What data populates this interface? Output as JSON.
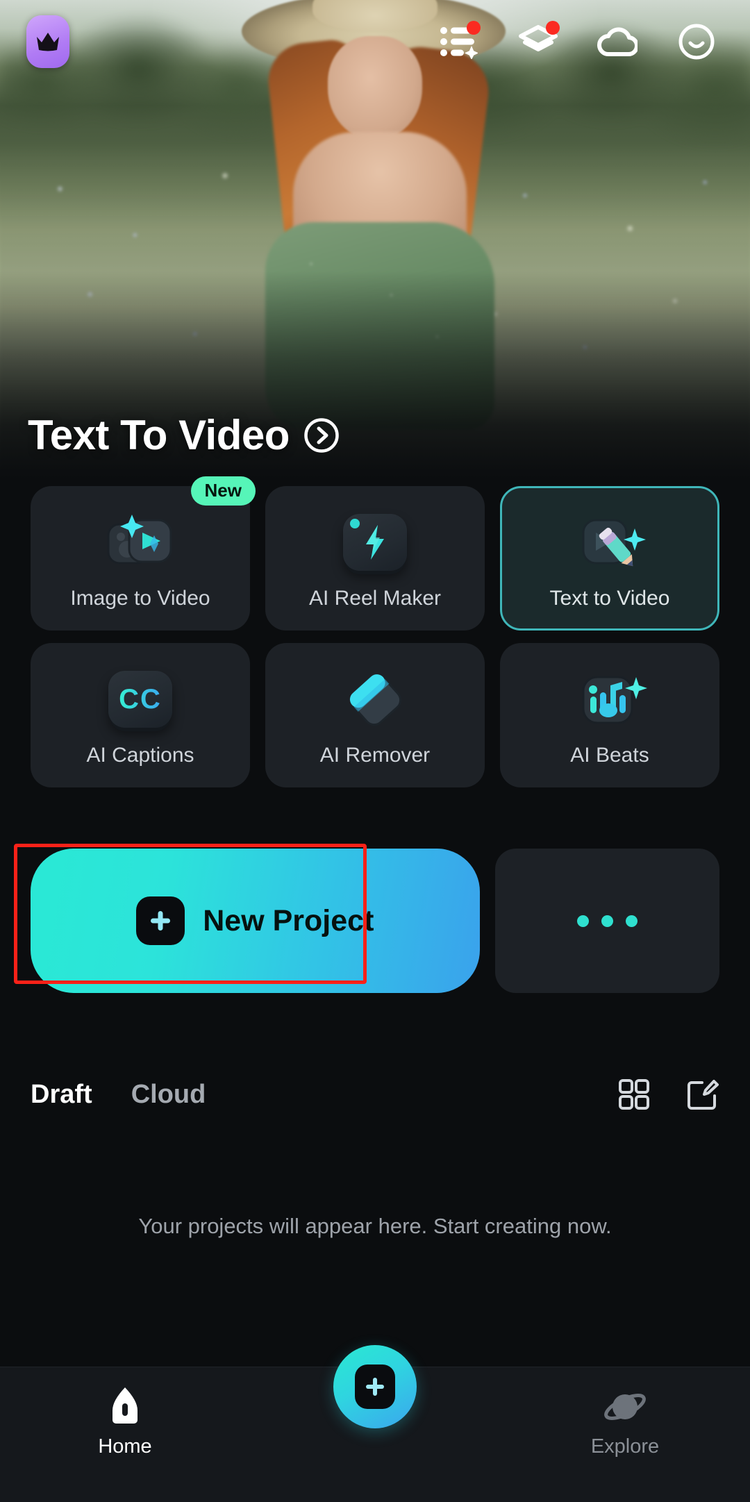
{
  "topbar": {
    "crown_icon": "crown-icon",
    "icons": [
      {
        "name": "ai-list-sparkle-icon",
        "badge": true
      },
      {
        "name": "graduation-cap-icon",
        "badge": true
      },
      {
        "name": "cloud-icon",
        "badge": false
      },
      {
        "name": "smiley-face-icon",
        "badge": false
      }
    ]
  },
  "hero": {
    "title": "Text To Video",
    "arrow_icon": "chevron-right-circle-icon"
  },
  "features": [
    {
      "label": "Image to Video",
      "icon": "image-to-video-icon",
      "badge": "New",
      "highlighted": false
    },
    {
      "label": "AI Reel Maker",
      "icon": "lightning-bolt-icon",
      "badge": "",
      "highlighted": false
    },
    {
      "label": "Text to Video",
      "icon": "pencil-play-icon",
      "badge": "",
      "highlighted": true
    },
    {
      "label": "AI Captions",
      "icon": "closed-caption-icon",
      "badge": "",
      "highlighted": false
    },
    {
      "label": "AI Remover",
      "icon": "eraser-icon",
      "badge": "",
      "highlighted": false
    },
    {
      "label": "AI Beats",
      "icon": "music-note-sparkle-icon",
      "badge": "",
      "highlighted": false
    }
  ],
  "new_project": {
    "label": "New Project",
    "plus_icon": "plus-icon",
    "more_icon": "more-horizontal-icon"
  },
  "projects": {
    "tabs": [
      {
        "label": "Draft",
        "active": true
      },
      {
        "label": "Cloud",
        "active": false
      }
    ],
    "grid_view_icon": "grid-view-icon",
    "edit_icon": "edit-square-icon",
    "empty_message": "Your projects will appear here. Start creating now."
  },
  "bottom_nav": {
    "home": {
      "label": "Home",
      "icon": "home-icon",
      "active": true
    },
    "create": {
      "icon": "plus-icon"
    },
    "explore": {
      "label": "Explore",
      "icon": "planet-icon",
      "active": false
    }
  },
  "colors": {
    "accent_teal": "#2ae9d5",
    "accent_blue": "#3aa2ec",
    "badge_green": "#56f5b8",
    "badge_red": "#fb2a21",
    "highlight_red": "#fb2118",
    "crown_purple": "#b07bf4"
  }
}
